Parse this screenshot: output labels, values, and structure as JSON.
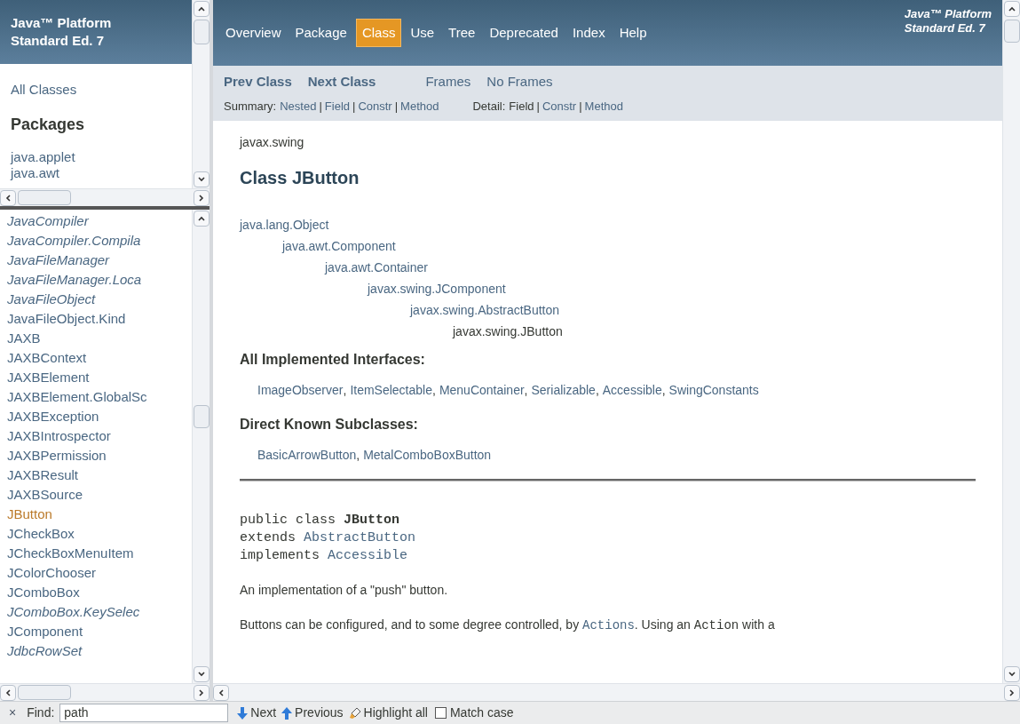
{
  "left_top": {
    "title": "Java™ Platform\nStandard Ed. 7",
    "all_classes": "All Classes",
    "packages_heading": "Packages",
    "packages": [
      "java.applet",
      "java.awt"
    ]
  },
  "class_list": [
    {
      "name": "JavaCompiler",
      "kind": "interface",
      "selected": false
    },
    {
      "name": "JavaCompiler.Compila",
      "kind": "interface",
      "selected": false
    },
    {
      "name": "JavaFileManager",
      "kind": "interface",
      "selected": false
    },
    {
      "name": "JavaFileManager.Loca",
      "kind": "interface",
      "selected": false
    },
    {
      "name": "JavaFileObject",
      "kind": "interface",
      "selected": false
    },
    {
      "name": "JavaFileObject.Kind",
      "kind": "class",
      "selected": false
    },
    {
      "name": "JAXB",
      "kind": "class",
      "selected": false
    },
    {
      "name": "JAXBContext",
      "kind": "class",
      "selected": false
    },
    {
      "name": "JAXBElement",
      "kind": "class",
      "selected": false
    },
    {
      "name": "JAXBElement.GlobalSc",
      "kind": "class",
      "selected": false
    },
    {
      "name": "JAXBException",
      "kind": "class",
      "selected": false
    },
    {
      "name": "JAXBIntrospector",
      "kind": "class",
      "selected": false
    },
    {
      "name": "JAXBPermission",
      "kind": "class",
      "selected": false
    },
    {
      "name": "JAXBResult",
      "kind": "class",
      "selected": false
    },
    {
      "name": "JAXBSource",
      "kind": "class",
      "selected": false
    },
    {
      "name": "JButton",
      "kind": "class",
      "selected": true
    },
    {
      "name": "JCheckBox",
      "kind": "class",
      "selected": false
    },
    {
      "name": "JCheckBoxMenuItem",
      "kind": "class",
      "selected": false
    },
    {
      "name": "JColorChooser",
      "kind": "class",
      "selected": false
    },
    {
      "name": "JComboBox",
      "kind": "class",
      "selected": false
    },
    {
      "name": "JComboBox.KeySelec",
      "kind": "interface",
      "selected": false
    },
    {
      "name": "JComponent",
      "kind": "class",
      "selected": false
    },
    {
      "name": "JdbcRowSet",
      "kind": "interface",
      "selected": false
    }
  ],
  "nav": {
    "tabs": [
      {
        "label": "Overview",
        "selected": false
      },
      {
        "label": "Package",
        "selected": false
      },
      {
        "label": "Class",
        "selected": true
      },
      {
        "label": "Use",
        "selected": false
      },
      {
        "label": "Tree",
        "selected": false
      },
      {
        "label": "Deprecated",
        "selected": false
      },
      {
        "label": "Index",
        "selected": false
      },
      {
        "label": "Help",
        "selected": false
      }
    ],
    "brand": "Java™ Platform\nStandard Ed. 7",
    "prev_next": [
      "Prev Class",
      "Next Class"
    ],
    "frames": [
      "Frames",
      "No Frames"
    ],
    "summary_label": "Summary:",
    "summary": [
      {
        "label": "Nested",
        "link": true
      },
      {
        "separator": "|",
        "label": "Field",
        "link": true
      },
      {
        "separator": "|",
        "label": "Constr",
        "link": true
      },
      {
        "separator": "|",
        "label": "Method",
        "link": true
      }
    ],
    "detail_label": "Detail:",
    "detail": [
      {
        "label": "Field",
        "link": false
      },
      {
        "separator": "|",
        "label": "Constr",
        "link": true
      },
      {
        "separator": "|",
        "label": "Method",
        "link": true
      }
    ]
  },
  "content": {
    "package": "javax.swing",
    "title": "Class JButton",
    "hierarchy": [
      {
        "name": "java.lang.Object",
        "link": true,
        "children": [
          {
            "name": "java.awt.Component",
            "link": true,
            "children": [
              {
                "name": "java.awt.Container",
                "link": true,
                "children": [
                  {
                    "name": "javax.swing.JComponent",
                    "link": true,
                    "children": [
                      {
                        "name": "javax.swing.AbstractButton",
                        "link": true,
                        "children": [
                          {
                            "name": "javax.swing.JButton",
                            "link": false
                          }
                        ]
                      }
                    ]
                  }
                ]
              }
            ]
          }
        ]
      }
    ],
    "interfaces_heading": "All Implemented Interfaces:",
    "interfaces": [
      {
        "name": "ImageObserver",
        "separator": ","
      },
      {
        "name": "ItemSelectable",
        "separator": ","
      },
      {
        "name": "MenuContainer",
        "separator": ","
      },
      {
        "name": "Serializable",
        "separator": ","
      },
      {
        "name": "Accessible",
        "separator": ","
      },
      {
        "name": "SwingConstants"
      }
    ],
    "subclasses_heading": "Direct Known Subclasses:",
    "subclasses": [
      {
        "name": "BasicArrowButton",
        "separator": ","
      },
      {
        "name": "MetalComboBoxButton"
      }
    ],
    "signature": [
      [
        {
          "text": "public class ",
          "kind": "plain"
        },
        {
          "text": "JButton",
          "kind": "bold"
        }
      ],
      [
        {
          "text": "extends ",
          "kind": "plain"
        },
        {
          "text": "AbstractButton",
          "kind": "link"
        }
      ],
      [
        {
          "text": "implements ",
          "kind": "plain"
        },
        {
          "text": "Accessible",
          "kind": "link"
        }
      ]
    ],
    "paragraphs": [
      [
        {
          "text": "An implementation of a \"push\" button.",
          "kind": "text"
        }
      ],
      [
        {
          "text": "Buttons can be configured, and to some degree controlled, by ",
          "kind": "text"
        },
        {
          "text": "Actions",
          "kind": "code-link"
        },
        {
          "text": ". Using an ",
          "kind": "text"
        },
        {
          "text": "Action",
          "kind": "code"
        },
        {
          "text": " with a",
          "kind": "text"
        }
      ]
    ]
  },
  "find_bar": {
    "close": "×",
    "label": "Find:",
    "value": "path",
    "next": "Next",
    "previous": "Previous",
    "highlight": "Highlight all",
    "match_case": {
      "label": "Match case",
      "checked": false
    }
  }
}
